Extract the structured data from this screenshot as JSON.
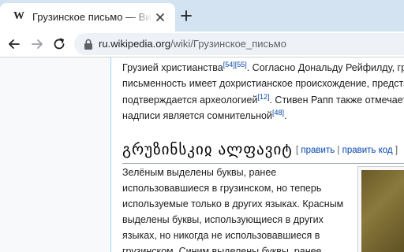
{
  "browser": {
    "tab": {
      "favicon": "W",
      "title": "Грузинское письмо — Википедия"
    },
    "new_tab_icon": "plus-icon",
    "url": {
      "host": "ru.wikipedia.org",
      "path": "/wiki/Грузинское_письмо"
    }
  },
  "article": {
    "paragraph1": {
      "line1_text": "Грузией христианства",
      "line1_cite1": "[54]",
      "line1_cite2": "[55]",
      "line1_rest": ". Согласно Дональду Рейфилду, грузинская",
      "line2": "письменность имеет дохристианское происхождение, представление",
      "line3_text": "подтверждается археологией",
      "line3_cite": "[12]",
      "line3_rest": ". Стивен Рапп также отмечает, что",
      "line4_text": "надписи является сомнительной",
      "line4_cite": "[48]",
      "line4_rest": "."
    },
    "section_heading": "გრუზინსკიჲ ალფავიტ",
    "edit_links": {
      "open": "[ ",
      "edit": "править",
      "sep": " | ",
      "edit_code": "править код",
      "close": " ]"
    },
    "paragraph2": [
      "Зелёным выделены буквы, ранее",
      "использовавшиеся в грузинском, но теперь",
      "используемые только в других языках. Красным",
      "выделены буквы, использующиеся в других",
      "языках, но никогда не использовавшиеся в",
      "грузинском. Синим выделены буквы, ранее"
    ]
  }
}
